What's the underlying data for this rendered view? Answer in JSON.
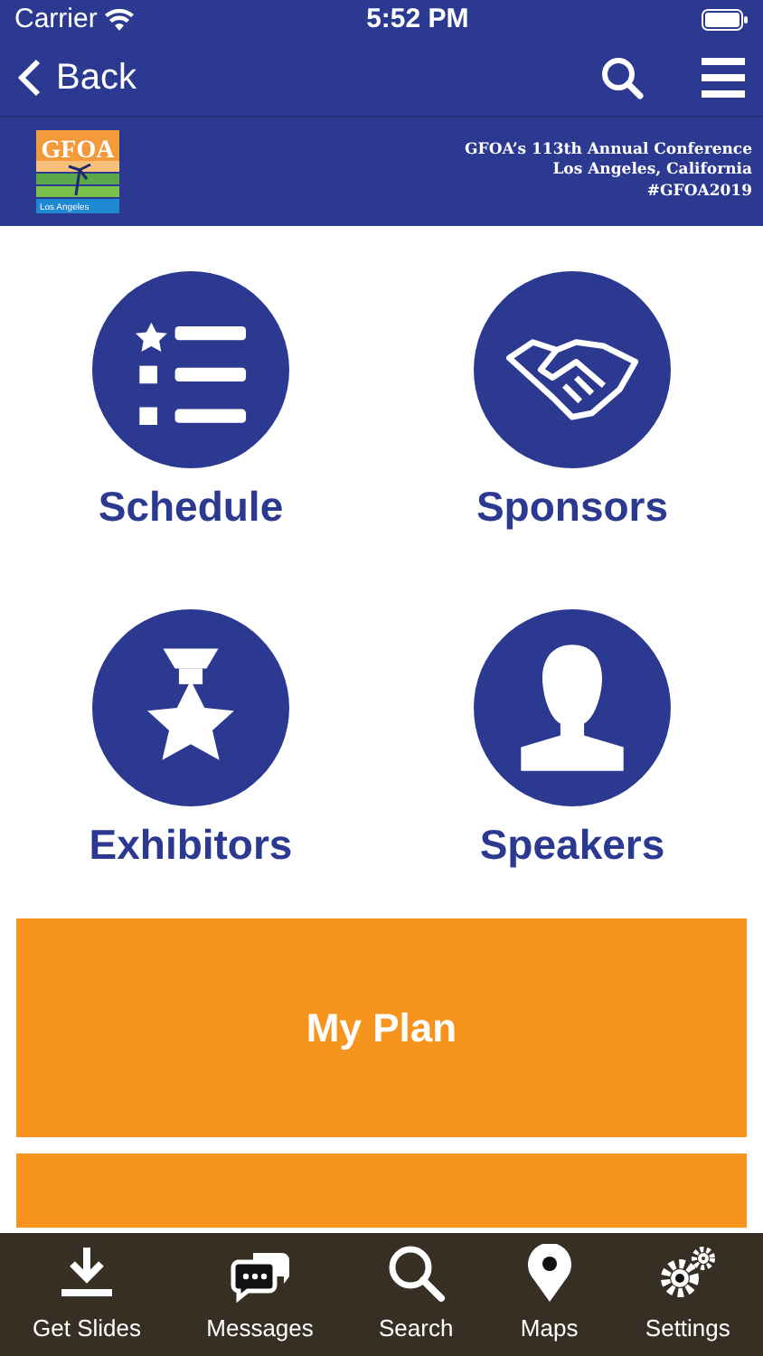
{
  "status_bar": {
    "carrier": "Carrier",
    "time": "5:52 PM"
  },
  "nav": {
    "back": "Back"
  },
  "banner": {
    "logo_title": "GFOA",
    "logo_city": "Los Angeles",
    "lines": [
      "GFOA’s 113th Annual Conference",
      "Los Angeles, California",
      "#GFOA2019"
    ]
  },
  "tiles": [
    {
      "label": "Schedule",
      "kind": "schedule"
    },
    {
      "label": "Sponsors",
      "kind": "sponsors"
    },
    {
      "label": "Exhibitors",
      "kind": "exhibitors"
    },
    {
      "label": "Speakers",
      "kind": "speakers"
    }
  ],
  "cards": [
    {
      "label": "My Plan"
    },
    {
      "kind": "cut"
    }
  ],
  "tab_bar": [
    {
      "label": "Get Slides",
      "kind": "download"
    },
    {
      "label": "Messages",
      "kind": "messages"
    },
    {
      "label": "Search",
      "kind": "search"
    },
    {
      "label": "Maps",
      "kind": "pin"
    },
    {
      "label": "Settings",
      "kind": "gears"
    }
  ]
}
